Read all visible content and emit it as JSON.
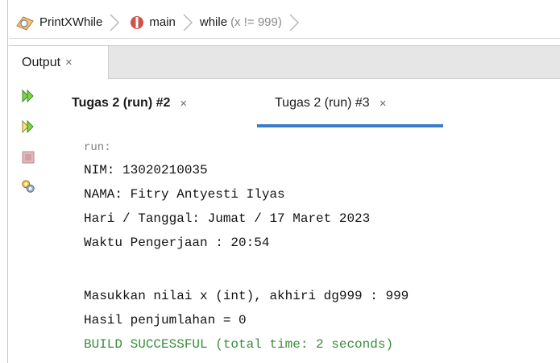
{
  "breadcrumb": {
    "items": [
      {
        "label": "PrintXWhile",
        "icon": "class-icon"
      },
      {
        "label": "main",
        "icon": "method-icon"
      },
      {
        "label": "while",
        "detail": "(x != 999)"
      }
    ]
  },
  "output_panel": {
    "tab_label": "Output",
    "close_glyph": "×"
  },
  "run_tabs": [
    {
      "label": "Tugas 2 (run) #2",
      "active": true
    },
    {
      "label": "Tugas 2 (run) #3",
      "active": false,
      "selected": true
    }
  ],
  "toolbar": {
    "icons": [
      "rerun-icon",
      "rerun-with-params-icon",
      "stop-icon",
      "settings-icon"
    ]
  },
  "console": {
    "run_label": "run:",
    "lines": [
      "NIM: 13020210035",
      "NAMA: Fitry Antyesti Ilyas",
      "Hari / Tanggal: Jumat / 17 Maret 2023",
      "Waktu Pengerjaan : 20:54",
      "",
      "Masukkan nilai x (int), akhiri dg999 : 999",
      "Hasil penjumlahan = 0"
    ],
    "success_line": "BUILD SUCCESSFUL (total time: 2 seconds)"
  },
  "colors": {
    "accent": "#3d7cc9",
    "success": "#3b8c3b",
    "run_icon": "#4caf2a"
  }
}
